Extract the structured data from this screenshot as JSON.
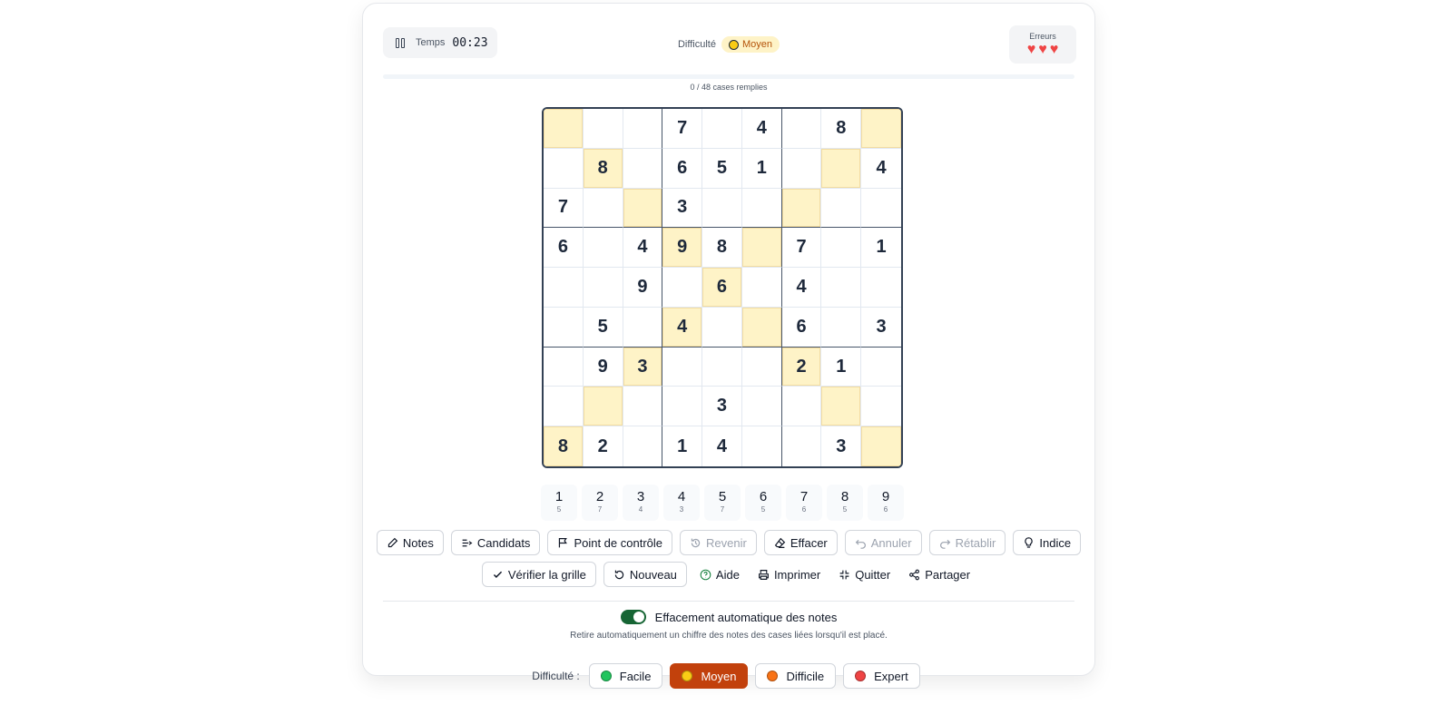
{
  "header": {
    "timer_label": "Temps",
    "timer_value": "00:23",
    "difficulty_label": "Difficulté",
    "difficulty_value": "Moyen",
    "errors_label": "Erreurs",
    "hearts": 3
  },
  "progress": {
    "text": "0 / 48 cases remplies",
    "fraction": 0
  },
  "grid": {
    "rows": [
      [
        "",
        "",
        "",
        "7",
        "",
        "4",
        "",
        "8",
        ""
      ],
      [
        "",
        "8",
        "",
        "6",
        "5",
        "1",
        "",
        "",
        "4"
      ],
      [
        "7",
        "",
        "",
        "3",
        "",
        "",
        "",
        "",
        ""
      ],
      [
        "6",
        "",
        "4",
        "9",
        "8",
        "",
        "7",
        "",
        "1"
      ],
      [
        "",
        "",
        "9",
        "",
        "6",
        "",
        "4",
        "",
        ""
      ],
      [
        "",
        "5",
        "",
        "4",
        "",
        "",
        "6",
        "",
        "3"
      ],
      [
        "",
        "9",
        "3",
        "",
        "",
        "",
        "2",
        "1",
        ""
      ],
      [
        "",
        "",
        "",
        "",
        "3",
        "",
        "",
        "",
        ""
      ],
      [
        "8",
        "2",
        "",
        "1",
        "4",
        "",
        "",
        "3",
        ""
      ]
    ],
    "highlighted": [
      [
        0,
        0
      ],
      [
        0,
        8
      ],
      [
        1,
        1
      ],
      [
        1,
        7
      ],
      [
        2,
        2
      ],
      [
        2,
        6
      ],
      [
        3,
        3
      ],
      [
        3,
        5
      ],
      [
        4,
        4
      ],
      [
        5,
        3
      ],
      [
        5,
        5
      ],
      [
        6,
        2
      ],
      [
        6,
        6
      ],
      [
        7,
        1
      ],
      [
        7,
        7
      ],
      [
        8,
        0
      ],
      [
        8,
        8
      ]
    ],
    "highlight_color": "#fef3c7"
  },
  "numpad": [
    {
      "digit": "1",
      "count": "5"
    },
    {
      "digit": "2",
      "count": "7"
    },
    {
      "digit": "3",
      "count": "4"
    },
    {
      "digit": "4",
      "count": "3"
    },
    {
      "digit": "5",
      "count": "7"
    },
    {
      "digit": "6",
      "count": "5"
    },
    {
      "digit": "7",
      "count": "6"
    },
    {
      "digit": "8",
      "count": "5"
    },
    {
      "digit": "9",
      "count": "6"
    }
  ],
  "toolbar": {
    "notes": "Notes",
    "candidates": "Candidats",
    "checkpoint": "Point de contrôle",
    "revert": "Revenir",
    "erase": "Effacer",
    "undo": "Annuler",
    "redo": "Rétablir",
    "hint": "Indice",
    "verify": "Vérifier la grille",
    "new_game": "Nouveau",
    "help": "Aide",
    "print": "Imprimer",
    "quit": "Quitter",
    "share": "Partager"
  },
  "settings": {
    "auto_erase_label": "Effacement automatique des notes",
    "auto_erase_on": true,
    "auto_erase_desc": "Retire automatiquement un chiffre des notes des cases liées lorsqu'il est placé."
  },
  "difficulty_bar": {
    "label": "Difficulté :",
    "options": [
      {
        "name": "Facile",
        "color": "#22c55e",
        "active": false
      },
      {
        "name": "Moyen",
        "color": "#facc15",
        "active": true
      },
      {
        "name": "Difficile",
        "color": "#f97316",
        "active": false
      },
      {
        "name": "Expert",
        "color": "#ef4444",
        "active": false
      }
    ]
  },
  "colors": {
    "accent": "#c2410c",
    "toggle_on": "#166534",
    "heart": "#ef4444"
  }
}
